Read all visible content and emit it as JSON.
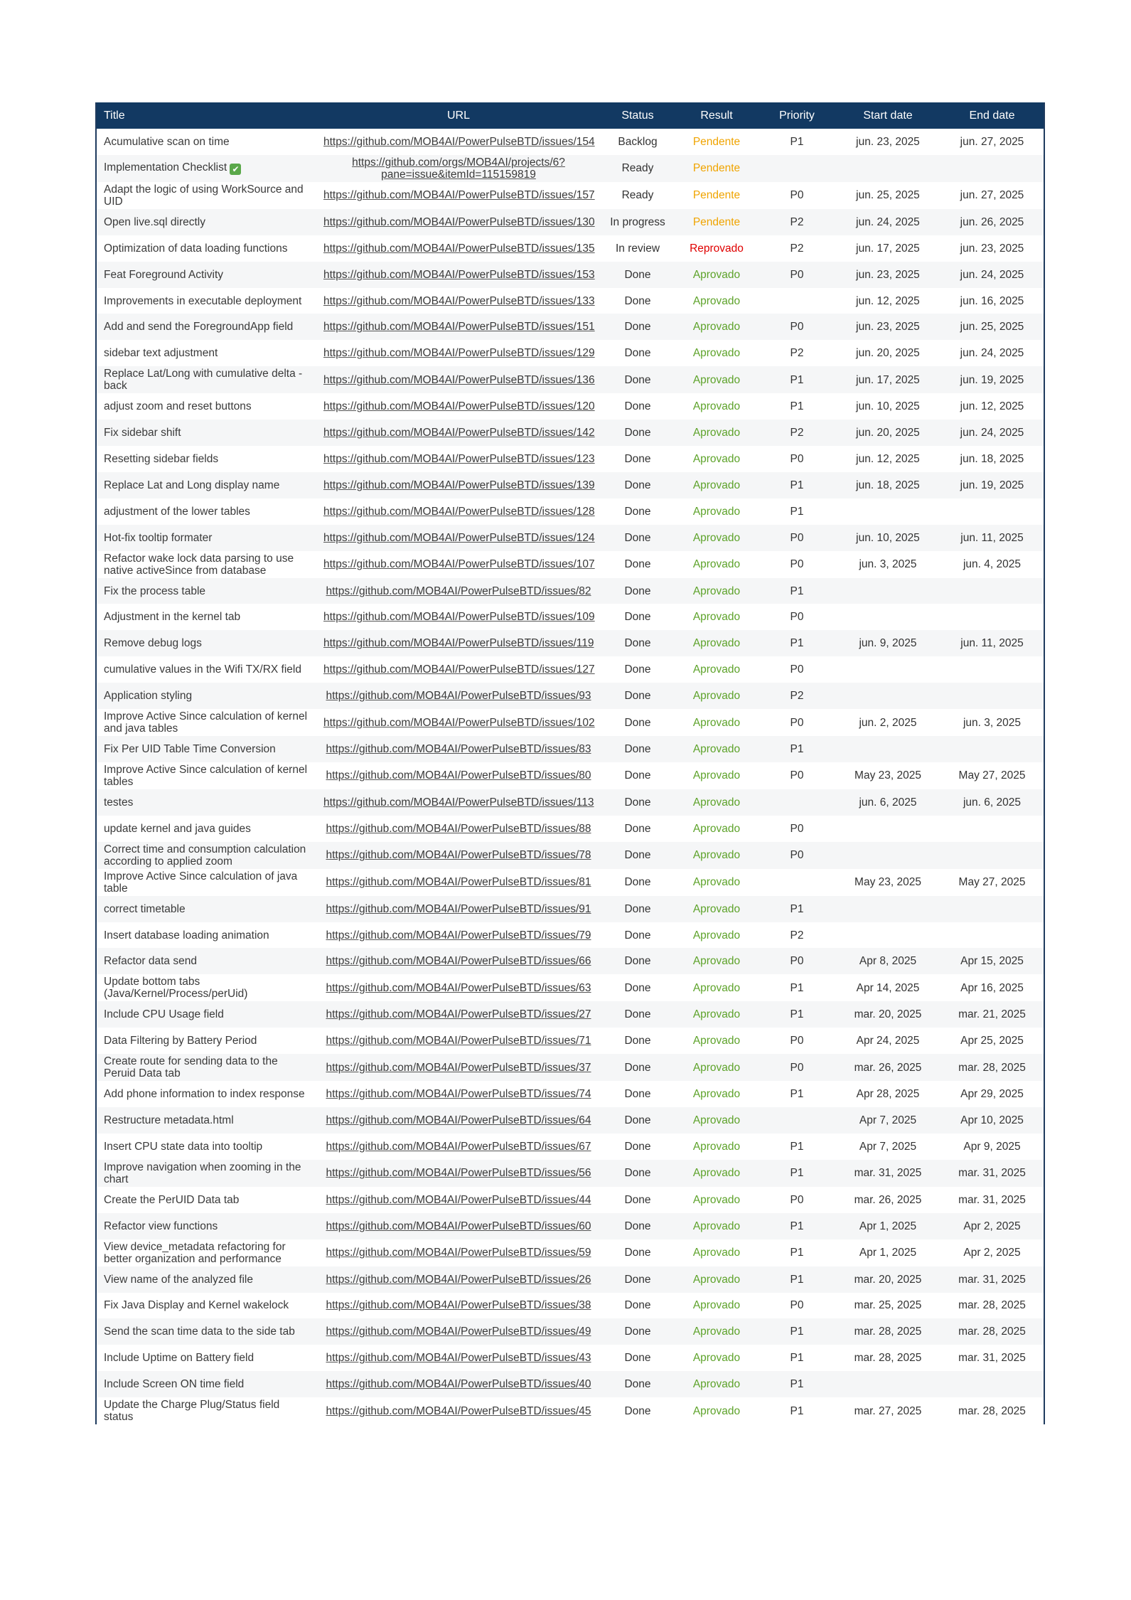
{
  "table": {
    "headers": {
      "title": "Title",
      "url": "URL",
      "status": "Status",
      "result": "Result",
      "priority": "Priority",
      "start": "Start date",
      "end": "End date"
    },
    "rows": [
      {
        "title": "Acumulative scan on time",
        "url": "https://github.com/MOB4AI/PowerPulseBTD/issues/154",
        "status": "Backlog",
        "result": "Pendente",
        "priority": "P1",
        "start": "jun. 23, 2025",
        "end": "jun. 27, 2025"
      },
      {
        "title": "Implementation Checklist",
        "url": "https://github.com/orgs/MOB4AI/projects/6?pane=issue&itemId=115159819",
        "status": "Ready",
        "result": "Pendente",
        "priority": "",
        "start": "",
        "end": "",
        "icon": "check-emoji-icon"
      },
      {
        "title": "Adapt the logic of using WorkSource and UID",
        "url": "https://github.com/MOB4AI/PowerPulseBTD/issues/157",
        "status": "Ready",
        "result": "Pendente",
        "priority": "P0",
        "start": "jun. 25, 2025",
        "end": "jun. 27, 2025"
      },
      {
        "title": "Open live.sql directly",
        "url": "https://github.com/MOB4AI/PowerPulseBTD/issues/130",
        "status": "In progress",
        "result": "Pendente",
        "priority": "P2",
        "start": "jun. 24, 2025",
        "end": "jun. 26, 2025"
      },
      {
        "title": "Optimization of data loading functions",
        "url": "https://github.com/MOB4AI/PowerPulseBTD/issues/135",
        "status": "In review",
        "result": "Reprovado",
        "priority": "P2",
        "start": "jun. 17, 2025",
        "end": "jun. 23, 2025"
      },
      {
        "title": "Feat Foreground Activity",
        "url": "https://github.com/MOB4AI/PowerPulseBTD/issues/153",
        "status": "Done",
        "result": "Aprovado",
        "priority": "P0",
        "start": "jun. 23, 2025",
        "end": "jun. 24, 2025"
      },
      {
        "title": "Improvements in executable deployment",
        "url": "https://github.com/MOB4AI/PowerPulseBTD/issues/133",
        "status": "Done",
        "result": "Aprovado",
        "priority": "",
        "start": "jun. 12, 2025",
        "end": "jun. 16, 2025"
      },
      {
        "title": "Add and send the ForegroundApp field",
        "url": "https://github.com/MOB4AI/PowerPulseBTD/issues/151",
        "status": "Done",
        "result": "Aprovado",
        "priority": "P0",
        "start": "jun. 23, 2025",
        "end": "jun. 25, 2025"
      },
      {
        "title": "sidebar text adjustment",
        "url": "https://github.com/MOB4AI/PowerPulseBTD/issues/129",
        "status": "Done",
        "result": "Aprovado",
        "priority": "P2",
        "start": "jun. 20, 2025",
        "end": "jun. 24, 2025"
      },
      {
        "title": "Replace Lat/Long with cumulative delta - back",
        "url": "https://github.com/MOB4AI/PowerPulseBTD/issues/136",
        "status": "Done",
        "result": "Aprovado",
        "priority": "P1",
        "start": "jun. 17, 2025",
        "end": "jun. 19, 2025"
      },
      {
        "title": "adjust zoom and reset buttons",
        "url": "https://github.com/MOB4AI/PowerPulseBTD/issues/120",
        "status": "Done",
        "result": "Aprovado",
        "priority": "P1",
        "start": "jun. 10, 2025",
        "end": "jun. 12, 2025"
      },
      {
        "title": "Fix sidebar shift",
        "url": "https://github.com/MOB4AI/PowerPulseBTD/issues/142",
        "status": "Done",
        "result": "Aprovado",
        "priority": "P2",
        "start": "jun. 20, 2025",
        "end": "jun. 24, 2025"
      },
      {
        "title": "Resetting sidebar fields",
        "url": "https://github.com/MOB4AI/PowerPulseBTD/issues/123",
        "status": "Done",
        "result": "Aprovado",
        "priority": "P0",
        "start": "jun. 12, 2025",
        "end": "jun. 18, 2025"
      },
      {
        "title": "Replace Lat and Long display name",
        "url": "https://github.com/MOB4AI/PowerPulseBTD/issues/139",
        "status": "Done",
        "result": "Aprovado",
        "priority": "P1",
        "start": "jun. 18, 2025",
        "end": "jun. 19, 2025"
      },
      {
        "title": "adjustment of the lower tables",
        "url": "https://github.com/MOB4AI/PowerPulseBTD/issues/128",
        "status": "Done",
        "result": "Aprovado",
        "priority": "P1",
        "start": "",
        "end": ""
      },
      {
        "title": "Hot-fix tooltip formater",
        "url": "https://github.com/MOB4AI/PowerPulseBTD/issues/124",
        "status": "Done",
        "result": "Aprovado",
        "priority": "P0",
        "start": "jun. 10, 2025",
        "end": "jun. 11, 2025"
      },
      {
        "title": "Refactor wake lock data parsing to use native activeSince from database",
        "url": "https://github.com/MOB4AI/PowerPulseBTD/issues/107",
        "status": "Done",
        "result": "Aprovado",
        "priority": "P0",
        "start": "jun. 3, 2025",
        "end": "jun. 4, 2025"
      },
      {
        "title": "Fix the process table",
        "url": "https://github.com/MOB4AI/PowerPulseBTD/issues/82",
        "status": "Done",
        "result": "Aprovado",
        "priority": "P1",
        "start": "",
        "end": ""
      },
      {
        "title": "Adjustment in the kernel tab",
        "url": "https://github.com/MOB4AI/PowerPulseBTD/issues/109",
        "status": "Done",
        "result": "Aprovado",
        "priority": "P0",
        "start": "",
        "end": ""
      },
      {
        "title": "Remove debug logs",
        "url": "https://github.com/MOB4AI/PowerPulseBTD/issues/119",
        "status": "Done",
        "result": "Aprovado",
        "priority": "P1",
        "start": "jun. 9, 2025",
        "end": "jun. 11, 2025"
      },
      {
        "title": "cumulative values in the Wifi TX/RX field",
        "url": "https://github.com/MOB4AI/PowerPulseBTD/issues/127",
        "status": "Done",
        "result": "Aprovado",
        "priority": "P0",
        "start": "",
        "end": ""
      },
      {
        "title": "Application styling",
        "url": "https://github.com/MOB4AI/PowerPulseBTD/issues/93",
        "status": "Done",
        "result": "Aprovado",
        "priority": "P2",
        "start": "",
        "end": ""
      },
      {
        "title": "Improve Active Since calculation of kernel and java tables",
        "url": "https://github.com/MOB4AI/PowerPulseBTD/issues/102",
        "status": "Done",
        "result": "Aprovado",
        "priority": "P0",
        "start": "jun. 2, 2025",
        "end": "jun. 3, 2025"
      },
      {
        "title": "Fix Per UID Table Time Conversion",
        "url": "https://github.com/MOB4AI/PowerPulseBTD/issues/83",
        "status": "Done",
        "result": "Aprovado",
        "priority": "P1",
        "start": "",
        "end": ""
      },
      {
        "title": "Improve Active Since calculation of kernel tables",
        "url": "https://github.com/MOB4AI/PowerPulseBTD/issues/80",
        "status": "Done",
        "result": "Aprovado",
        "priority": "P0",
        "start": "May 23, 2025",
        "end": "May 27, 2025"
      },
      {
        "title": "testes",
        "url": "https://github.com/MOB4AI/PowerPulseBTD/issues/113",
        "status": "Done",
        "result": "Aprovado",
        "priority": "",
        "start": "jun. 6, 2025",
        "end": "jun. 6, 2025"
      },
      {
        "title": "update kernel and java guides",
        "url": "https://github.com/MOB4AI/PowerPulseBTD/issues/88",
        "status": "Done",
        "result": "Aprovado",
        "priority": "P0",
        "start": "",
        "end": ""
      },
      {
        "title": "Correct time and consumption calculation according to applied zoom",
        "url": "https://github.com/MOB4AI/PowerPulseBTD/issues/78",
        "status": "Done",
        "result": "Aprovado",
        "priority": "P0",
        "start": "",
        "end": ""
      },
      {
        "title": "Improve Active Since calculation of java table",
        "url": "https://github.com/MOB4AI/PowerPulseBTD/issues/81",
        "status": "Done",
        "result": "Aprovado",
        "priority": "",
        "start": "May 23, 2025",
        "end": "May 27, 2025"
      },
      {
        "title": "correct timetable",
        "url": "https://github.com/MOB4AI/PowerPulseBTD/issues/91",
        "status": "Done",
        "result": "Aprovado",
        "priority": "P1",
        "start": "",
        "end": ""
      },
      {
        "title": "Insert database loading animation",
        "url": "https://github.com/MOB4AI/PowerPulseBTD/issues/79",
        "status": "Done",
        "result": "Aprovado",
        "priority": "P2",
        "start": "",
        "end": ""
      },
      {
        "title": "Refactor data send",
        "url": "https://github.com/MOB4AI/PowerPulseBTD/issues/66",
        "status": "Done",
        "result": "Aprovado",
        "priority": "P0",
        "start": "Apr 8, 2025",
        "end": "Apr 15, 2025"
      },
      {
        "title": "Update bottom tabs (Java/Kernel/Process/perUid)",
        "url": "https://github.com/MOB4AI/PowerPulseBTD/issues/63",
        "status": "Done",
        "result": "Aprovado",
        "priority": "P1",
        "start": "Apr 14, 2025",
        "end": "Apr 16, 2025"
      },
      {
        "title": "Include CPU Usage field",
        "url": "https://github.com/MOB4AI/PowerPulseBTD/issues/27",
        "status": "Done",
        "result": "Aprovado",
        "priority": "P1",
        "start": "mar. 20, 2025",
        "end": "mar. 21, 2025"
      },
      {
        "title": "Data Filtering by Battery Period",
        "url": "https://github.com/MOB4AI/PowerPulseBTD/issues/71",
        "status": "Done",
        "result": "Aprovado",
        "priority": "P0",
        "start": "Apr 24, 2025",
        "end": "Apr 25, 2025"
      },
      {
        "title": "Create route for sending data to the Peruid Data tab",
        "url": "https://github.com/MOB4AI/PowerPulseBTD/issues/37",
        "status": "Done",
        "result": "Aprovado",
        "priority": "P0",
        "start": "mar. 26, 2025",
        "end": "mar. 28, 2025"
      },
      {
        "title": "Add phone information to index response",
        "url": "https://github.com/MOB4AI/PowerPulseBTD/issues/74",
        "status": "Done",
        "result": "Aprovado",
        "priority": "P1",
        "start": "Apr 28, 2025",
        "end": "Apr 29, 2025"
      },
      {
        "title": "Restructure metadata.html",
        "url": "https://github.com/MOB4AI/PowerPulseBTD/issues/64",
        "status": "Done",
        "result": "Aprovado",
        "priority": "",
        "start": "Apr 7, 2025",
        "end": "Apr 10, 2025"
      },
      {
        "title": "Insert CPU state data into tooltip",
        "url": "https://github.com/MOB4AI/PowerPulseBTD/issues/67",
        "status": "Done",
        "result": "Aprovado",
        "priority": "P1",
        "start": "Apr 7, 2025",
        "end": "Apr 9, 2025"
      },
      {
        "title": "Improve navigation when zooming in the chart",
        "url": "https://github.com/MOB4AI/PowerPulseBTD/issues/56",
        "status": "Done",
        "result": "Aprovado",
        "priority": "P1",
        "start": "mar. 31, 2025",
        "end": "mar. 31, 2025"
      },
      {
        "title": "Create the PerUID Data tab",
        "url": "https://github.com/MOB4AI/PowerPulseBTD/issues/44",
        "status": "Done",
        "result": "Aprovado",
        "priority": "P0",
        "start": "mar. 26, 2025",
        "end": "mar. 31, 2025"
      },
      {
        "title": "Refactor view functions",
        "url": "https://github.com/MOB4AI/PowerPulseBTD/issues/60",
        "status": "Done",
        "result": "Aprovado",
        "priority": "P1",
        "start": "Apr 1, 2025",
        "end": "Apr 2, 2025"
      },
      {
        "title": "View device_metadata refactoring for better organization and performance",
        "url": "https://github.com/MOB4AI/PowerPulseBTD/issues/59",
        "status": "Done",
        "result": "Aprovado",
        "priority": "P1",
        "start": "Apr 1, 2025",
        "end": "Apr 2, 2025"
      },
      {
        "title": "View name of the analyzed file",
        "url": "https://github.com/MOB4AI/PowerPulseBTD/issues/26",
        "status": "Done",
        "result": "Aprovado",
        "priority": "P1",
        "start": "mar. 20, 2025",
        "end": "mar. 31, 2025"
      },
      {
        "title": "Fix Java Display and Kernel wakelock",
        "url": "https://github.com/MOB4AI/PowerPulseBTD/issues/38",
        "status": "Done",
        "result": "Aprovado",
        "priority": "P0",
        "start": "mar. 25, 2025",
        "end": "mar. 28, 2025"
      },
      {
        "title": "Send the scan time data to the side tab",
        "url": "https://github.com/MOB4AI/PowerPulseBTD/issues/49",
        "status": "Done",
        "result": "Aprovado",
        "priority": "P1",
        "start": "mar. 28, 2025",
        "end": "mar. 28, 2025"
      },
      {
        "title": "Include Uptime on Battery field",
        "url": "https://github.com/MOB4AI/PowerPulseBTD/issues/43",
        "status": "Done",
        "result": "Aprovado",
        "priority": "P1",
        "start": "mar. 28, 2025",
        "end": "mar. 31, 2025"
      },
      {
        "title": "Include Screen ON time field",
        "url": "https://github.com/MOB4AI/PowerPulseBTD/issues/40",
        "status": "Done",
        "result": "Aprovado",
        "priority": "P1",
        "start": "",
        "end": ""
      },
      {
        "title": "Update the Charge Plug/Status field status",
        "url": "https://github.com/MOB4AI/PowerPulseBTD/issues/45",
        "status": "Done",
        "result": "Aprovado",
        "priority": "P1",
        "start": "mar. 27, 2025",
        "end": "mar. 28, 2025"
      }
    ]
  }
}
